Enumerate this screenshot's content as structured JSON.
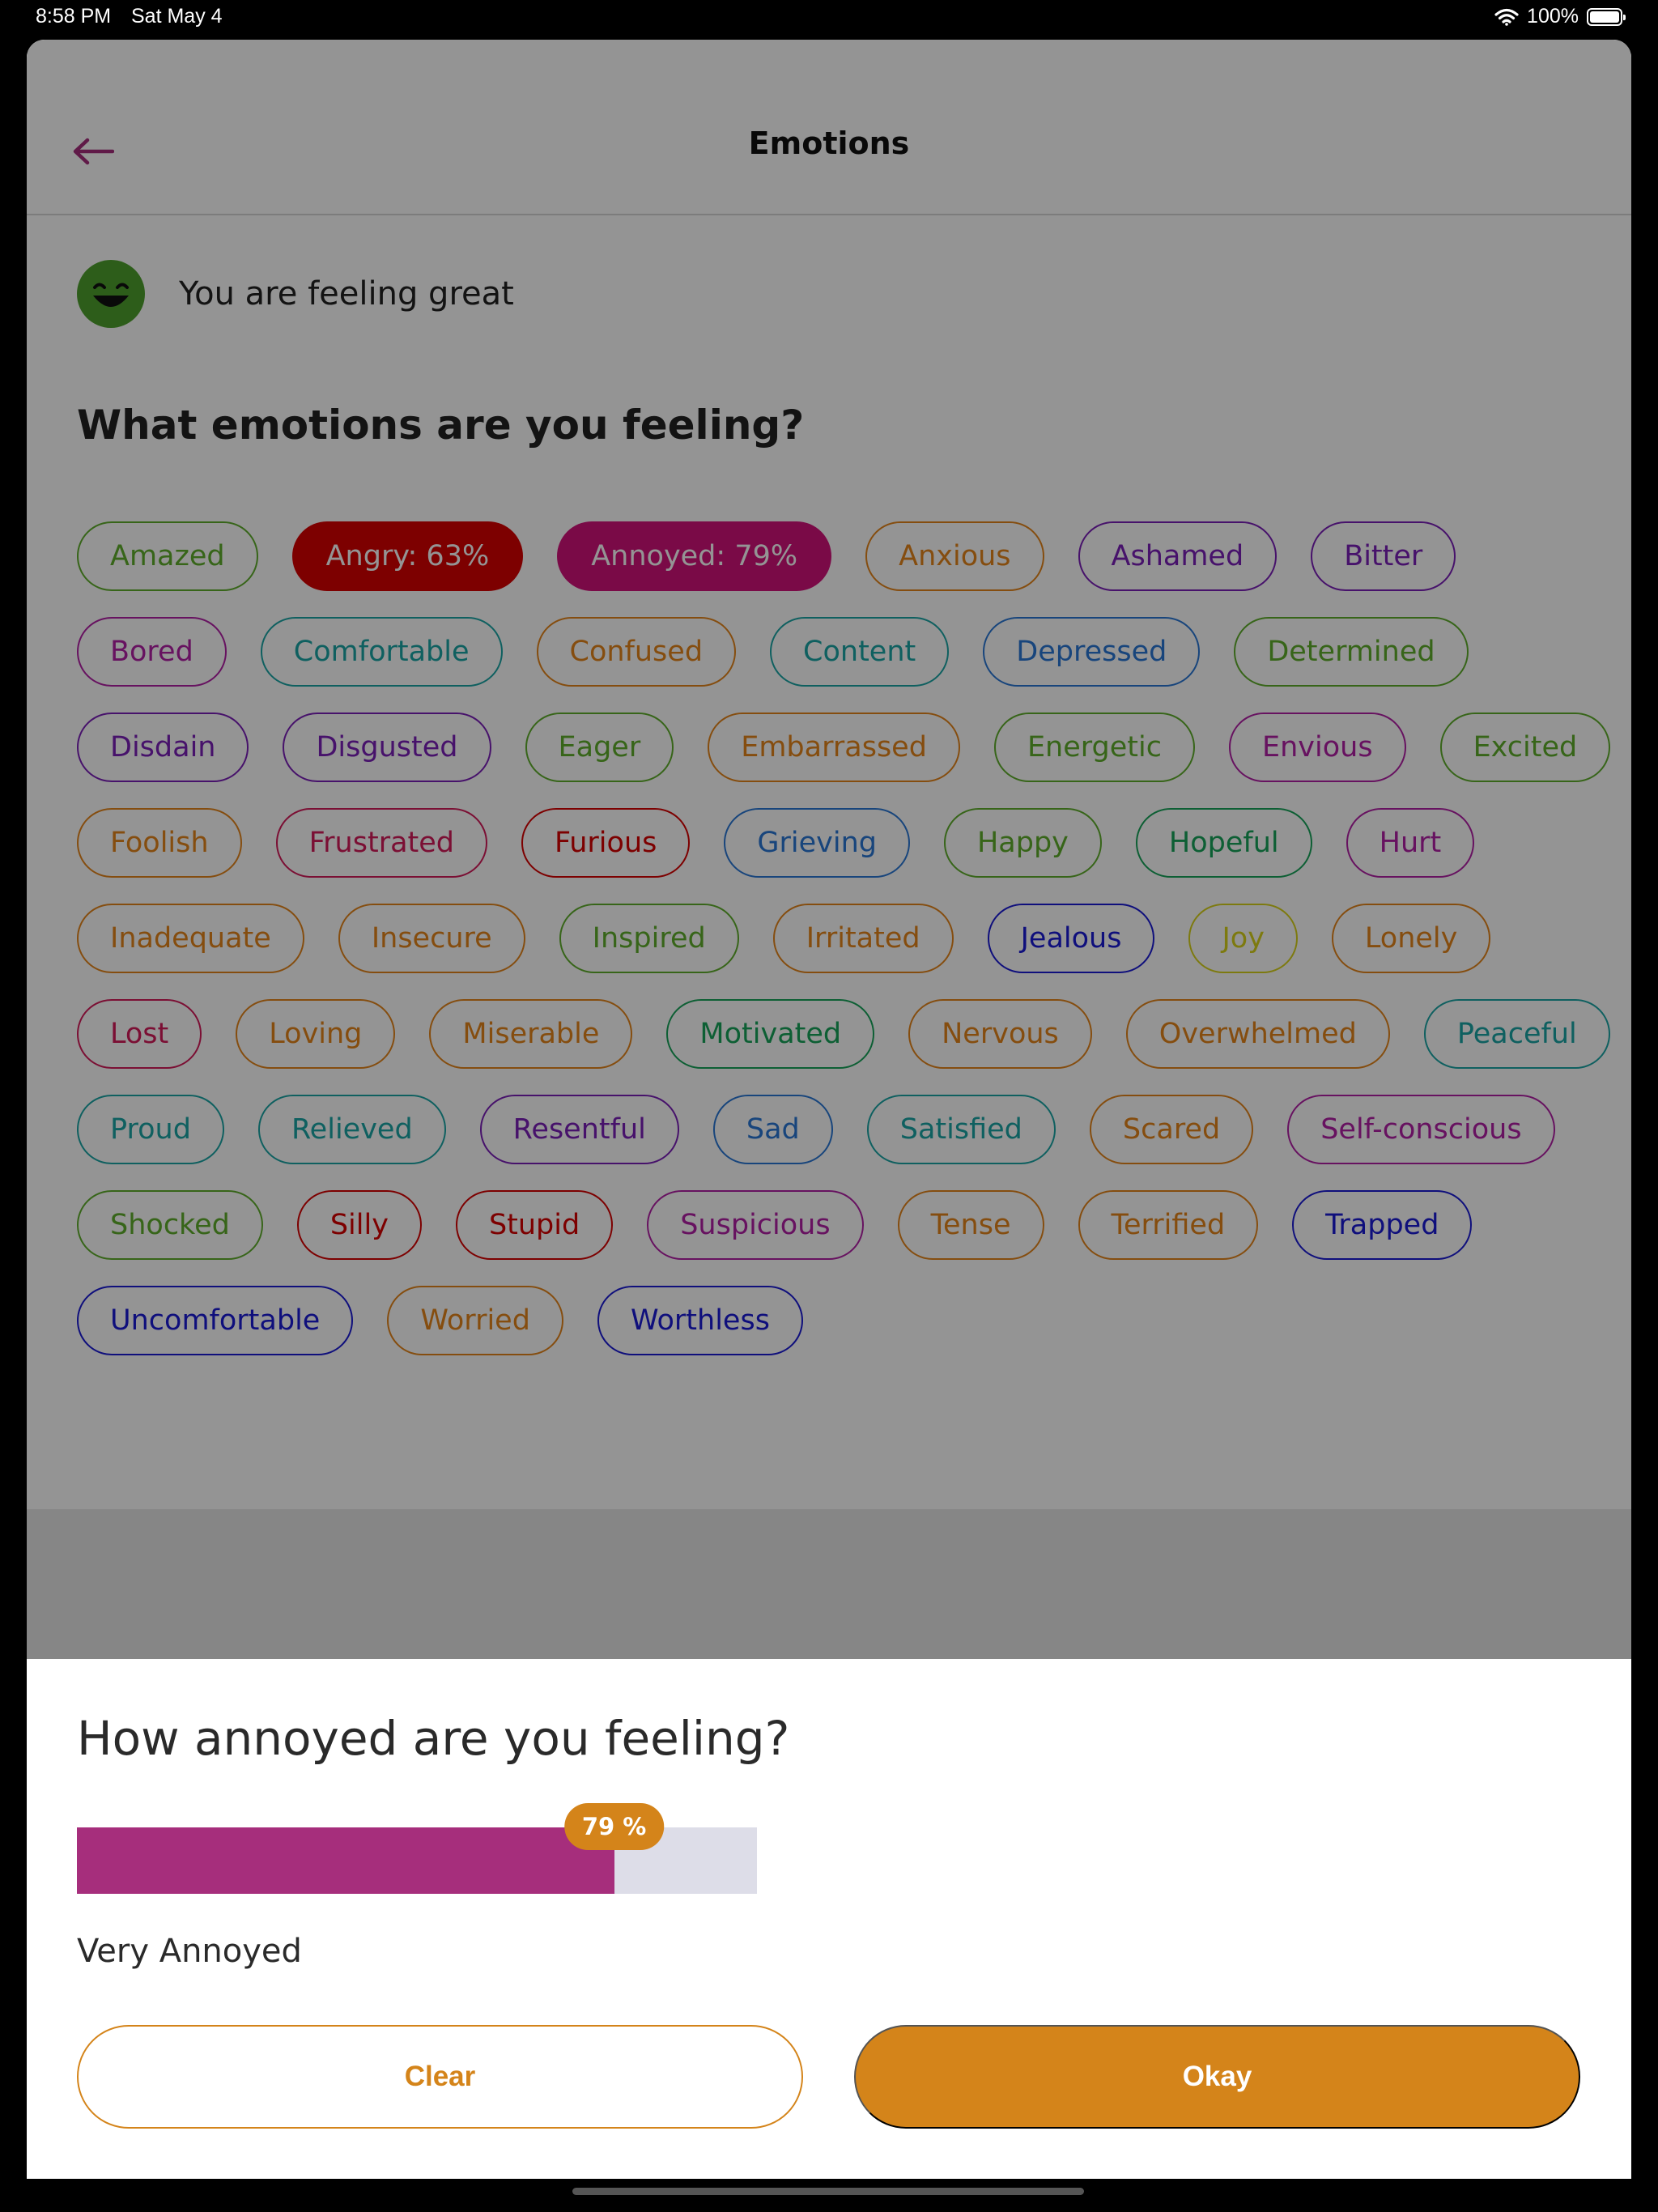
{
  "status_bar": {
    "time": "8:58 PM",
    "date": "Sat May 4",
    "battery": "100%"
  },
  "header": {
    "title": "Emotions"
  },
  "mood": {
    "text": "You are feeling great"
  },
  "emotions_section": {
    "title": "What emotions are you feeling?"
  },
  "emotions": [
    {
      "label": "Amazed",
      "color": "#5fae2c"
    },
    {
      "label": "Angry: 63%",
      "color": "#d70000",
      "selected": true
    },
    {
      "label": "Annoyed: 79%",
      "color": "#d2127a",
      "selected": true
    },
    {
      "label": "Anxious",
      "color": "#e5861b"
    },
    {
      "label": "Ashamed",
      "color": "#7a1fb8"
    },
    {
      "label": "Bitter",
      "color": "#7a1fb8"
    },
    {
      "label": "Bored",
      "color": "#b11fa6"
    },
    {
      "label": "Comfortable",
      "color": "#1aa5a5"
    },
    {
      "label": "Confused",
      "color": "#e5861b"
    },
    {
      "label": "Content",
      "color": "#1aa5a5"
    },
    {
      "label": "Depressed",
      "color": "#2a78d6"
    },
    {
      "label": "Determined",
      "color": "#5fae2c"
    },
    {
      "label": "Disdain",
      "color": "#7a1fb8"
    },
    {
      "label": "Disgusted",
      "color": "#7a1fb8"
    },
    {
      "label": "Eager",
      "color": "#5fae2c"
    },
    {
      "label": "Embarrassed",
      "color": "#e5861b"
    },
    {
      "label": "Energetic",
      "color": "#5fae2c"
    },
    {
      "label": "Envious",
      "color": "#b11fa6"
    },
    {
      "label": "Excited",
      "color": "#5fae2c"
    },
    {
      "label": "Foolish",
      "color": "#e5861b"
    },
    {
      "label": "Frustrated",
      "color": "#d41a5a"
    },
    {
      "label": "Furious",
      "color": "#d70000"
    },
    {
      "label": "Grieving",
      "color": "#2a78d6"
    },
    {
      "label": "Happy",
      "color": "#5fae2c"
    },
    {
      "label": "Hopeful",
      "color": "#18a45a"
    },
    {
      "label": "Hurt",
      "color": "#b11fa6"
    },
    {
      "label": "Inadequate",
      "color": "#e5861b"
    },
    {
      "label": "Insecure",
      "color": "#e5861b"
    },
    {
      "label": "Inspired",
      "color": "#5fae2c"
    },
    {
      "label": "Irritated",
      "color": "#e5861b"
    },
    {
      "label": "Jealous",
      "color": "#1a1ad6"
    },
    {
      "label": "Joy",
      "color": "#d8d21a"
    },
    {
      "label": "Lonely",
      "color": "#e5861b"
    },
    {
      "label": "Lost",
      "color": "#d41a5a"
    },
    {
      "label": "Loving",
      "color": "#e5861b"
    },
    {
      "label": "Miserable",
      "color": "#e5861b"
    },
    {
      "label": "Motivated",
      "color": "#18a45a"
    },
    {
      "label": "Nervous",
      "color": "#e5861b"
    },
    {
      "label": "Overwhelmed",
      "color": "#e5861b"
    },
    {
      "label": "Peaceful",
      "color": "#1aa5a5"
    },
    {
      "label": "Proud",
      "color": "#1aa5a5"
    },
    {
      "label": "Relieved",
      "color": "#1aa5a5"
    },
    {
      "label": "Resentful",
      "color": "#7a1fb8"
    },
    {
      "label": "Sad",
      "color": "#2a78d6"
    },
    {
      "label": "Satisfied",
      "color": "#1aa5a5"
    },
    {
      "label": "Scared",
      "color": "#e5861b"
    },
    {
      "label": "Self-conscious",
      "color": "#b11fa6"
    },
    {
      "label": "Shocked",
      "color": "#5fae2c"
    },
    {
      "label": "Silly",
      "color": "#d70000"
    },
    {
      "label": "Stupid",
      "color": "#d70000"
    },
    {
      "label": "Suspicious",
      "color": "#b11fa6"
    },
    {
      "label": "Tense",
      "color": "#e5861b"
    },
    {
      "label": "Terrified",
      "color": "#e5861b"
    },
    {
      "label": "Trapped",
      "color": "#1a1ad6"
    },
    {
      "label": "Uncomfortable",
      "color": "#1a1ad6"
    },
    {
      "label": "Worried",
      "color": "#e5861b"
    },
    {
      "label": "Worthless",
      "color": "#1a1ad6"
    }
  ],
  "sheet": {
    "title": "How annoyed are you feeling?",
    "slider": {
      "value": 79,
      "badge": "79 %",
      "fill_color": "#a62e7c",
      "track_color": "#dddde8",
      "badge_color": "#d4841a"
    },
    "level_label": "Very Annoyed",
    "clear_label": "Clear",
    "okay_label": "Okay"
  },
  "colors": {
    "accent": "#d4841a",
    "back_arrow": "#a62e7c",
    "mood_face": "#4fa12e"
  },
  "icons": {
    "back": "back-arrow-icon",
    "mood": "smiley-face-icon",
    "wifi": "wifi-icon",
    "battery": "battery-icon"
  }
}
